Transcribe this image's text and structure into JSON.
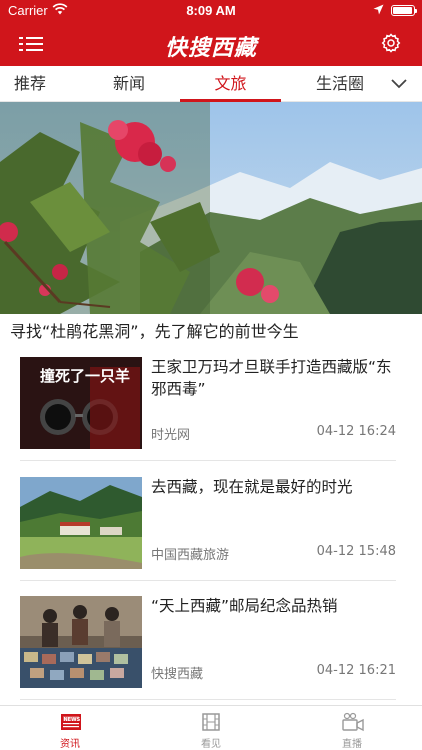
{
  "status_bar": {
    "carrier": "Carrier",
    "time": "8:09 AM",
    "battery_level": 0.95
  },
  "header": {
    "app_title": "快搜西藏",
    "menu_icon": "menu-list-icon",
    "settings_icon": "gear-icon"
  },
  "tabs": [
    {
      "label": "推荐",
      "active": false
    },
    {
      "label": "新闻",
      "active": false
    },
    {
      "label": "文旅",
      "active": true
    },
    {
      "label": "生活圈",
      "active": false
    }
  ],
  "hero": {
    "title": "寻找“杜鹃花黑洞”，先了解它的前世今生"
  },
  "news": [
    {
      "title": "王家卫万玛才旦联手打造西藏版“东邪西毒”",
      "source": "时光网",
      "time": "04-12 16:24",
      "thumb_text": "撞死了一只羊"
    },
    {
      "title": "去西藏，现在就是最好的时光",
      "source": "中国西藏旅游",
      "time": "04-12 15:48"
    },
    {
      "title": "“天上西藏”邮局纪念品热销",
      "source": "快搜西藏",
      "time": "04-12 16:21"
    }
  ],
  "bottom_nav": [
    {
      "label": "资讯",
      "icon": "news-icon",
      "active": true
    },
    {
      "label": "看见",
      "icon": "film-icon",
      "active": false
    },
    {
      "label": "直播",
      "icon": "video-camera-icon",
      "active": false
    }
  ],
  "colors": {
    "brand_red": "#d0151b",
    "text_dark": "#222222",
    "text_meta": "#777777"
  }
}
